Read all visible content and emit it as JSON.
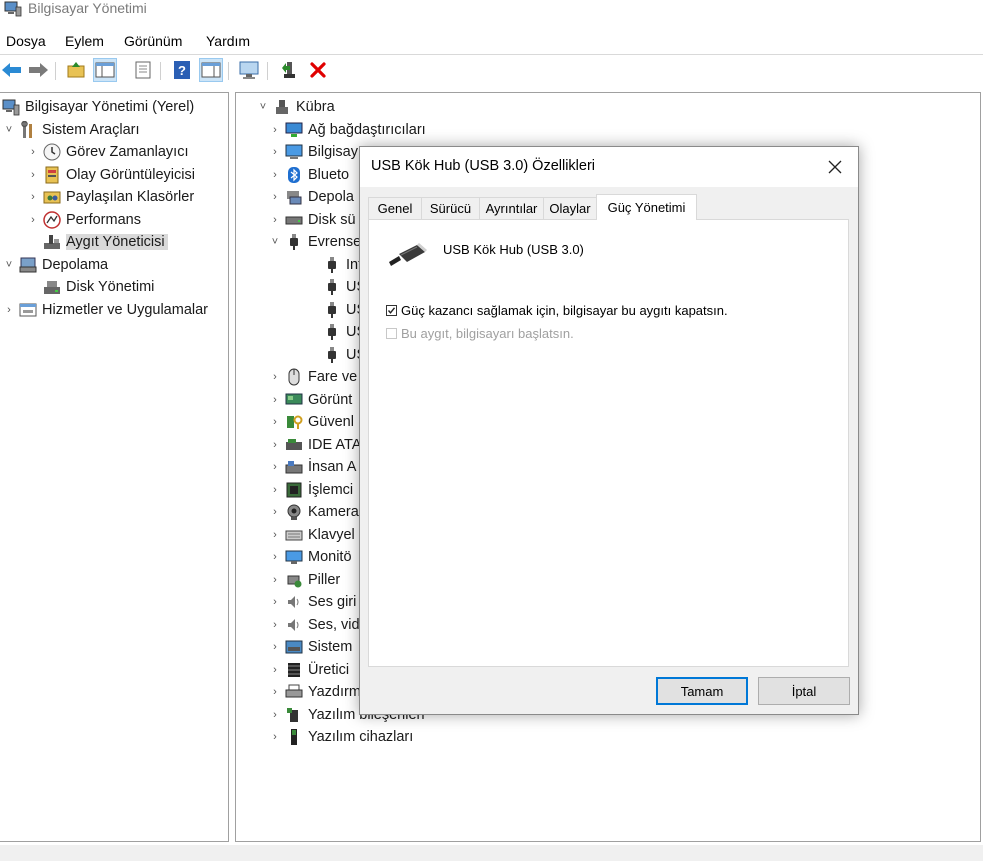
{
  "window": {
    "title": "Bilgisayar Yönetimi"
  },
  "menu": [
    "Dosya",
    "Eylem",
    "Görünüm",
    "Yardım"
  ],
  "toolbar": {
    "icons": [
      "back-arrow-icon",
      "forward-arrow-icon",
      "up-folder-icon",
      "show-hide-tree-icon",
      "properties-icon",
      "help-icon",
      "action-pane-icon",
      "monitor-icon",
      "update-driver-icon",
      "uninstall-icon"
    ],
    "colors": {
      "back": "#2a8ad4",
      "forward": "#7a7a7a",
      "delete": "#e00000",
      "update": "#2b8a2b"
    }
  },
  "tree": {
    "root": "Bilgisayar Yönetimi (Yerel)",
    "system_tools": "Sistem Araçları",
    "task_scheduler": "Görev Zamanlayıcı",
    "event_viewer": "Olay Görüntüleyicisi",
    "shared_folders": "Paylaşılan Klasörler",
    "performance": "Performans",
    "device_manager": "Aygıt Yöneticisi",
    "storage": "Depolama",
    "disk_management": "Disk Yönetimi",
    "services": "Hizmetler ve Uygulamalar"
  },
  "devices": {
    "computer": "Kübra",
    "categories": [
      "Ağ bağdaştırıcıları",
      "Bilgisay",
      "Blueto",
      "Depola",
      "Disk sü",
      "Evrense"
    ],
    "usb_children": [
      "Inte",
      "USB",
      "USB",
      "USB",
      "USB"
    ],
    "more": [
      "Fare ve",
      "Görünt",
      "Güvenl",
      "IDE ATA",
      "İnsan A",
      "İşlemci",
      "Kamera",
      "Klavyel",
      "Monitö",
      "Piller",
      "Ses giri",
      "Ses, vid",
      "Sistem",
      "Üretici",
      "Yazdırm",
      "Yazılım bileşenleri",
      "Yazılım cihazları"
    ]
  },
  "dialog": {
    "title": "USB Kök Hub (USB 3.0) Özellikleri",
    "tabs": [
      "Genel",
      "Sürücü",
      "Ayrıntılar",
      "Olaylar",
      "Güç Yönetimi"
    ],
    "active_tab": "Güç Yönetimi",
    "device_name": "USB Kök Hub (USB 3.0)",
    "options": [
      {
        "label": "Güç kazancı sağlamak için, bilgisayar bu aygıtı kapatsın.",
        "checked": true,
        "enabled": true
      },
      {
        "label": "Bu aygıt, bilgisayarı başlatsın.",
        "checked": false,
        "enabled": false
      }
    ],
    "ok_label": "Tamam",
    "cancel_label": "İptal"
  }
}
